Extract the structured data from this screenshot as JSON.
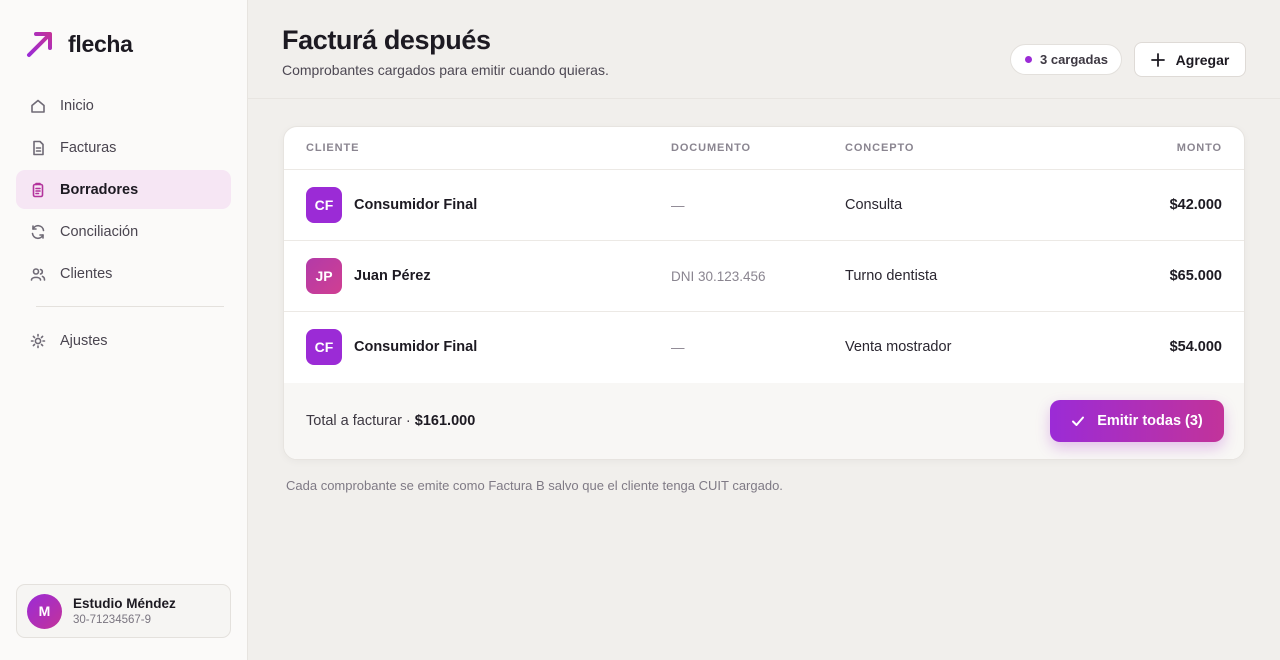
{
  "brand": {
    "name": "flecha",
    "accent": "#9b2bd6",
    "accent2": "#c2339a"
  },
  "sidebar": {
    "items": [
      {
        "label": "Inicio",
        "icon": "home-icon",
        "active": false
      },
      {
        "label": "Facturas",
        "icon": "document-icon",
        "active": false
      },
      {
        "label": "Borradores",
        "icon": "clipboard-icon",
        "active": true
      },
      {
        "label": "Conciliación",
        "icon": "refresh-icon",
        "active": false
      },
      {
        "label": "Clientes",
        "icon": "users-icon",
        "active": false
      }
    ],
    "settings": {
      "label": "Ajustes",
      "icon": "sun-gear-icon"
    },
    "account": {
      "initial": "M",
      "name": "Estudio Méndez",
      "cuit": "30-71234567-9"
    }
  },
  "header": {
    "title": "Facturá después",
    "subtitle": "Comprobantes cargados para emitir cuando quieras.",
    "badge": "3 cargadas",
    "add_label": "Agregar"
  },
  "table": {
    "columns": [
      "CLIENTE",
      "DOCUMENTO",
      "CONCEPTO",
      "MONTO"
    ],
    "rows": [
      {
        "initials": "CF",
        "client": "Consumidor Final",
        "document": "—",
        "concept": "Consulta",
        "amount": "$42.000"
      },
      {
        "initials": "JP",
        "client": "Juan Pérez",
        "document": "DNI 30.123.456",
        "concept": "Turno dentista",
        "amount": "$65.000"
      },
      {
        "initials": "CF",
        "client": "Consumidor Final",
        "document": "—",
        "concept": "Venta mostrador",
        "amount": "$54.000"
      }
    ],
    "total_label": "Total a facturar · ",
    "total_value": "$161.000",
    "emit_label": "Emitir todas (3)"
  },
  "note": "Cada comprobante se emite como Factura B salvo que el cliente tenga CUIT cargado."
}
